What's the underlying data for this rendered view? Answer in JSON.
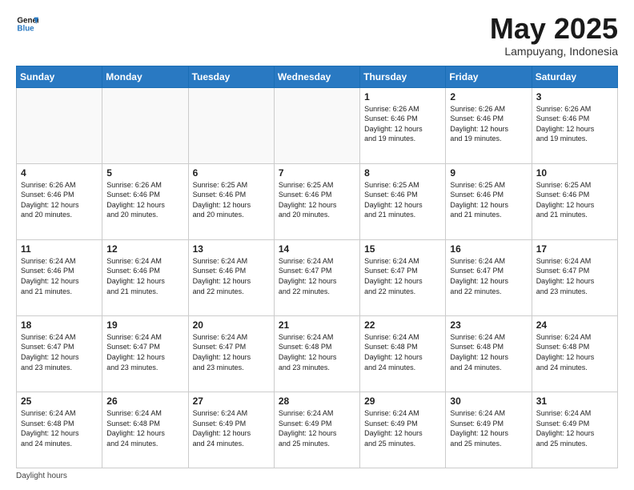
{
  "header": {
    "logo_text_general": "General",
    "logo_text_blue": "Blue",
    "month_title": "May 2025",
    "location": "Lampuyang, Indonesia"
  },
  "days_of_week": [
    "Sunday",
    "Monday",
    "Tuesday",
    "Wednesday",
    "Thursday",
    "Friday",
    "Saturday"
  ],
  "weeks": [
    [
      {
        "day": "",
        "info": ""
      },
      {
        "day": "",
        "info": ""
      },
      {
        "day": "",
        "info": ""
      },
      {
        "day": "",
        "info": ""
      },
      {
        "day": "1",
        "info": "Sunrise: 6:26 AM\nSunset: 6:46 PM\nDaylight: 12 hours\nand 19 minutes."
      },
      {
        "day": "2",
        "info": "Sunrise: 6:26 AM\nSunset: 6:46 PM\nDaylight: 12 hours\nand 19 minutes."
      },
      {
        "day": "3",
        "info": "Sunrise: 6:26 AM\nSunset: 6:46 PM\nDaylight: 12 hours\nand 19 minutes."
      }
    ],
    [
      {
        "day": "4",
        "info": "Sunrise: 6:26 AM\nSunset: 6:46 PM\nDaylight: 12 hours\nand 20 minutes."
      },
      {
        "day": "5",
        "info": "Sunrise: 6:26 AM\nSunset: 6:46 PM\nDaylight: 12 hours\nand 20 minutes."
      },
      {
        "day": "6",
        "info": "Sunrise: 6:25 AM\nSunset: 6:46 PM\nDaylight: 12 hours\nand 20 minutes."
      },
      {
        "day": "7",
        "info": "Sunrise: 6:25 AM\nSunset: 6:46 PM\nDaylight: 12 hours\nand 20 minutes."
      },
      {
        "day": "8",
        "info": "Sunrise: 6:25 AM\nSunset: 6:46 PM\nDaylight: 12 hours\nand 21 minutes."
      },
      {
        "day": "9",
        "info": "Sunrise: 6:25 AM\nSunset: 6:46 PM\nDaylight: 12 hours\nand 21 minutes."
      },
      {
        "day": "10",
        "info": "Sunrise: 6:25 AM\nSunset: 6:46 PM\nDaylight: 12 hours\nand 21 minutes."
      }
    ],
    [
      {
        "day": "11",
        "info": "Sunrise: 6:24 AM\nSunset: 6:46 PM\nDaylight: 12 hours\nand 21 minutes."
      },
      {
        "day": "12",
        "info": "Sunrise: 6:24 AM\nSunset: 6:46 PM\nDaylight: 12 hours\nand 21 minutes."
      },
      {
        "day": "13",
        "info": "Sunrise: 6:24 AM\nSunset: 6:46 PM\nDaylight: 12 hours\nand 22 minutes."
      },
      {
        "day": "14",
        "info": "Sunrise: 6:24 AM\nSunset: 6:47 PM\nDaylight: 12 hours\nand 22 minutes."
      },
      {
        "day": "15",
        "info": "Sunrise: 6:24 AM\nSunset: 6:47 PM\nDaylight: 12 hours\nand 22 minutes."
      },
      {
        "day": "16",
        "info": "Sunrise: 6:24 AM\nSunset: 6:47 PM\nDaylight: 12 hours\nand 22 minutes."
      },
      {
        "day": "17",
        "info": "Sunrise: 6:24 AM\nSunset: 6:47 PM\nDaylight: 12 hours\nand 23 minutes."
      }
    ],
    [
      {
        "day": "18",
        "info": "Sunrise: 6:24 AM\nSunset: 6:47 PM\nDaylight: 12 hours\nand 23 minutes."
      },
      {
        "day": "19",
        "info": "Sunrise: 6:24 AM\nSunset: 6:47 PM\nDaylight: 12 hours\nand 23 minutes."
      },
      {
        "day": "20",
        "info": "Sunrise: 6:24 AM\nSunset: 6:47 PM\nDaylight: 12 hours\nand 23 minutes."
      },
      {
        "day": "21",
        "info": "Sunrise: 6:24 AM\nSunset: 6:48 PM\nDaylight: 12 hours\nand 23 minutes."
      },
      {
        "day": "22",
        "info": "Sunrise: 6:24 AM\nSunset: 6:48 PM\nDaylight: 12 hours\nand 24 minutes."
      },
      {
        "day": "23",
        "info": "Sunrise: 6:24 AM\nSunset: 6:48 PM\nDaylight: 12 hours\nand 24 minutes."
      },
      {
        "day": "24",
        "info": "Sunrise: 6:24 AM\nSunset: 6:48 PM\nDaylight: 12 hours\nand 24 minutes."
      }
    ],
    [
      {
        "day": "25",
        "info": "Sunrise: 6:24 AM\nSunset: 6:48 PM\nDaylight: 12 hours\nand 24 minutes."
      },
      {
        "day": "26",
        "info": "Sunrise: 6:24 AM\nSunset: 6:48 PM\nDaylight: 12 hours\nand 24 minutes."
      },
      {
        "day": "27",
        "info": "Sunrise: 6:24 AM\nSunset: 6:49 PM\nDaylight: 12 hours\nand 24 minutes."
      },
      {
        "day": "28",
        "info": "Sunrise: 6:24 AM\nSunset: 6:49 PM\nDaylight: 12 hours\nand 25 minutes."
      },
      {
        "day": "29",
        "info": "Sunrise: 6:24 AM\nSunset: 6:49 PM\nDaylight: 12 hours\nand 25 minutes."
      },
      {
        "day": "30",
        "info": "Sunrise: 6:24 AM\nSunset: 6:49 PM\nDaylight: 12 hours\nand 25 minutes."
      },
      {
        "day": "31",
        "info": "Sunrise: 6:24 AM\nSunset: 6:49 PM\nDaylight: 12 hours\nand 25 minutes."
      }
    ]
  ],
  "footer": {
    "note": "Daylight hours"
  }
}
